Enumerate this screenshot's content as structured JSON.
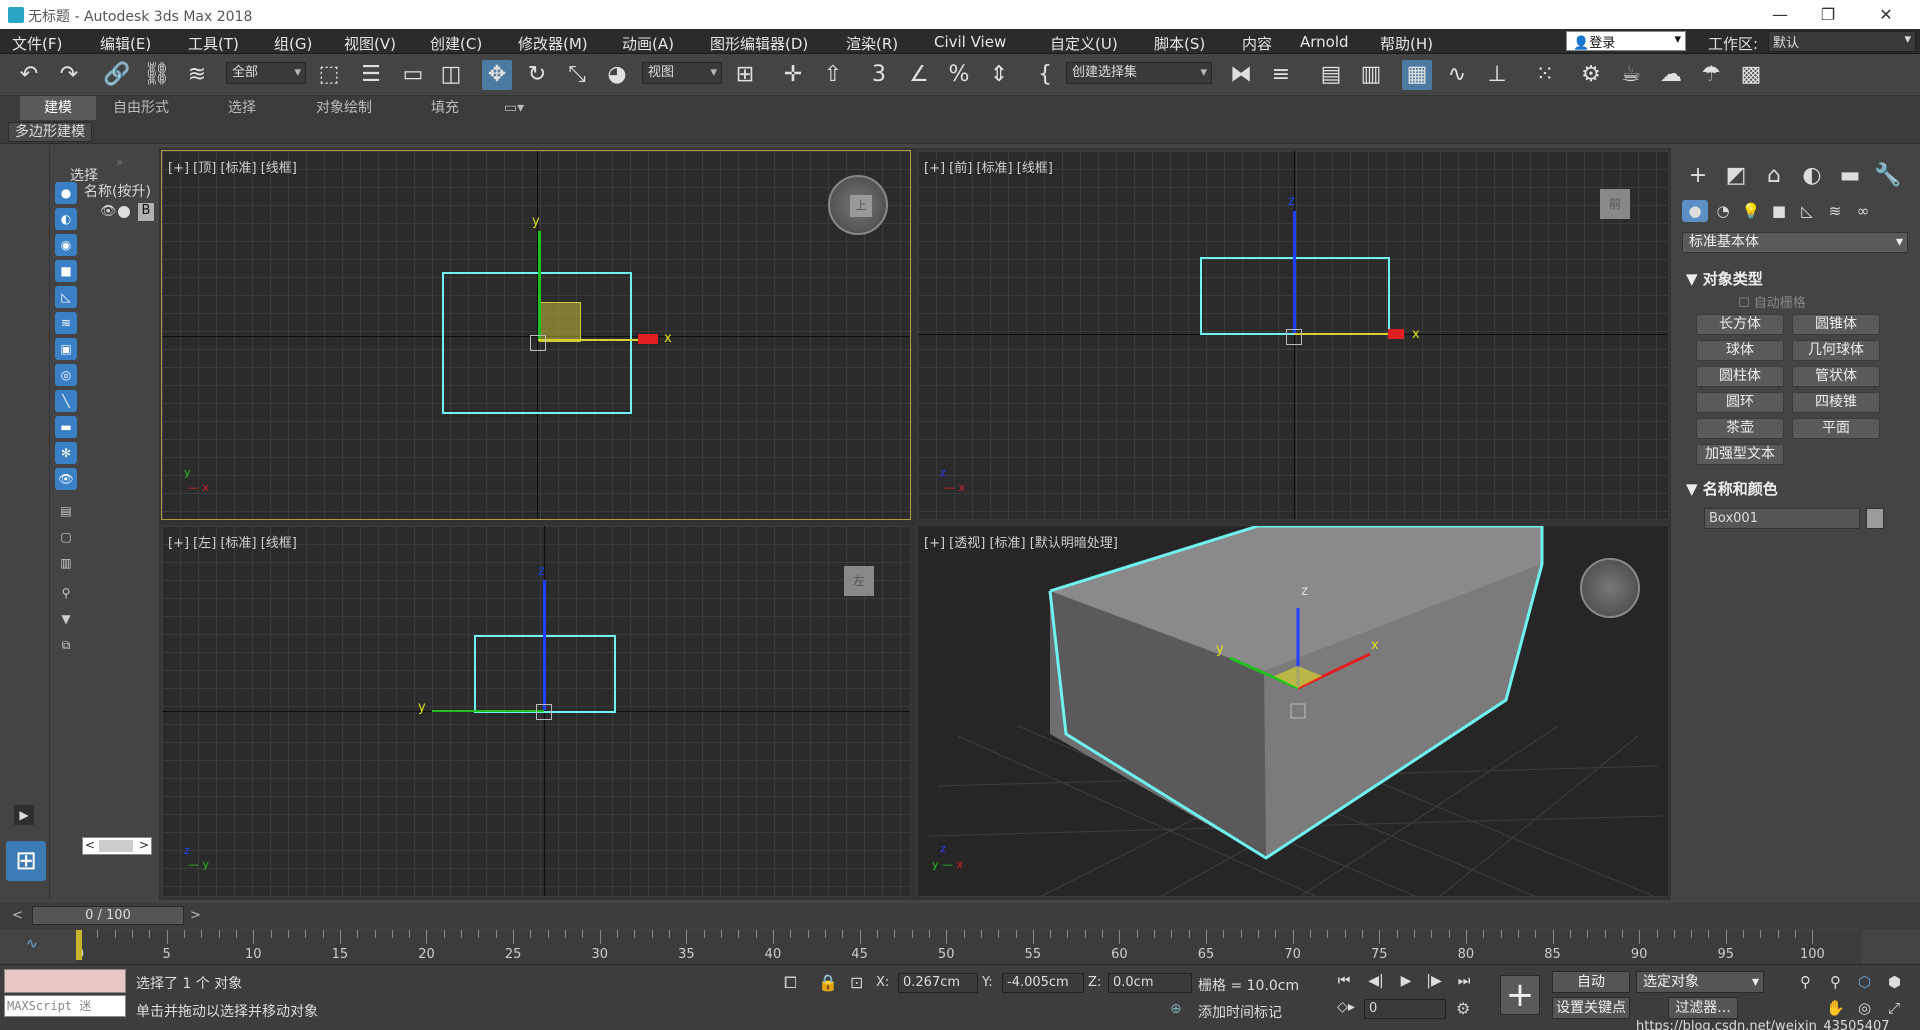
{
  "window": {
    "title": "无标题 - Autodesk 3ds Max 2018",
    "min": "—",
    "max": "❐",
    "close": "✕"
  },
  "menu": [
    "文件(F)",
    "编辑(E)",
    "工具(T)",
    "组(G)",
    "视图(V)",
    "创建(C)",
    "修改器(M)",
    "动画(A)",
    "图形编辑器(D)",
    "渲染(R)",
    "Civil View",
    "自定义(U)",
    "脚本(S)",
    "内容",
    "Arnold",
    "帮助(H)"
  ],
  "login": {
    "label": "登录"
  },
  "workspace": {
    "label": "工作区:",
    "value": "默认"
  },
  "toolbar": {
    "filter": "全部",
    "refcoord": "视图",
    "selset": "创建选择集"
  },
  "ribbon": {
    "tabs": [
      "建模",
      "自由形式",
      "选择",
      "对象绘制",
      "填充"
    ],
    "active": "建模",
    "sub": "多边形建模"
  },
  "scene_explorer": {
    "title": "选择",
    "column": "名称(按升)",
    "item": "B"
  },
  "viewports": {
    "top": "[+] [顶] [标准] [线框]",
    "front": "[+] [前] [标准] [线框]",
    "left": "[+] [左] [标准] [线框]",
    "persp": "[+] [透视] [标准] [默认明暗处理]",
    "cube_top": "上",
    "cube_front": "前",
    "cube_left": "左",
    "axis_x": "x",
    "axis_y": "y",
    "axis_z": "z"
  },
  "command_panel": {
    "category": "标准基本体",
    "rollout_objtype": "对象类型",
    "autogrid": "自动栅格",
    "buttons": [
      "长方体",
      "圆锥体",
      "球体",
      "几何球体",
      "圆柱体",
      "管状体",
      "圆环",
      "四棱锥",
      "茶壶",
      "平面"
    ],
    "extended_text": "加强型文本",
    "rollout_namecolor": "名称和颜色",
    "object_name": "Box001",
    "object_color": "#9c9c9c"
  },
  "timeline": {
    "slider": "0 / 100",
    "ticks": [
      "0",
      "5",
      "10",
      "15",
      "20",
      "25",
      "30",
      "35",
      "40",
      "45",
      "50",
      "55",
      "60",
      "65",
      "70",
      "75",
      "80",
      "85",
      "90",
      "95",
      "100"
    ]
  },
  "status": {
    "maxscript": "MAXScript 迷",
    "selected": "选择了 1 个 对象",
    "prompt": "单击并拖动以选择并移动对象",
    "x_label": "X:",
    "x": "0.267cm",
    "y_label": "Y:",
    "y": "-4.005cm",
    "z_label": "Z:",
    "z": "0.0cm",
    "grid": "栅格 = 10.0cm",
    "add_time_tag": "添加时间标记",
    "auto": "自动",
    "selected_obj": "选定对象",
    "set_key": "设置关键点",
    "filter": "过滤器...",
    "frame": "0",
    "watermark": "https://blog.csdn.net/weixin_43505407"
  },
  "colors": {
    "selection": "#6ff2f2",
    "x_axis": "#e02020",
    "y_axis": "#20c020",
    "z_axis": "#2040ff",
    "active_vp": "#b59a3b"
  }
}
